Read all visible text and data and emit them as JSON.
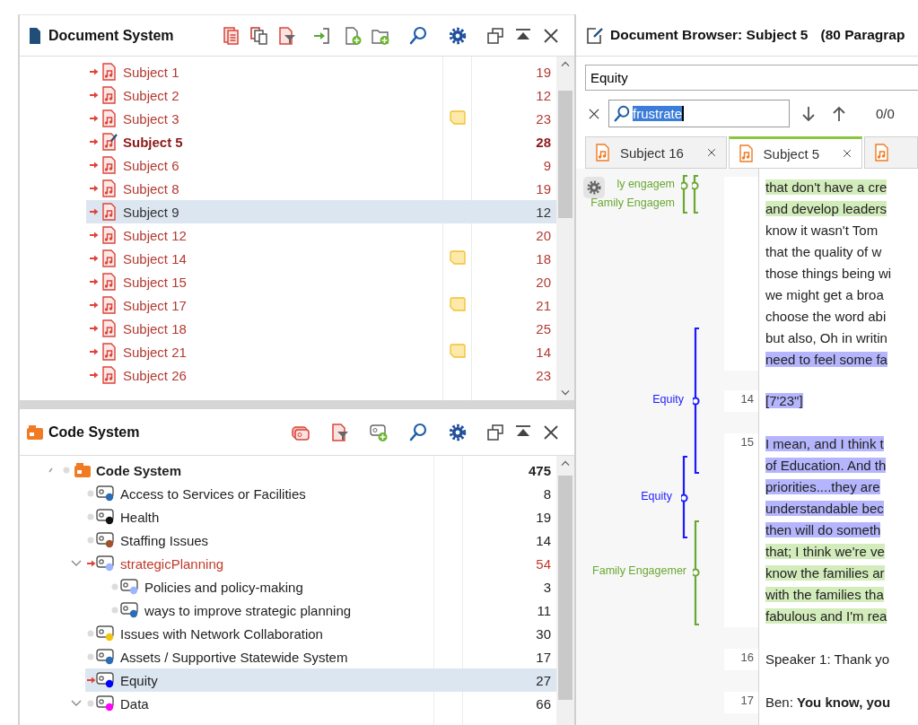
{
  "document_system": {
    "title": "Document System",
    "items": [
      {
        "name": "Subject 1",
        "count": "19",
        "activated": true,
        "selected": false,
        "open": false,
        "memo": false
      },
      {
        "name": "Subject 2",
        "count": "12",
        "activated": true,
        "selected": false,
        "open": false,
        "memo": false
      },
      {
        "name": "Subject 3",
        "count": "23",
        "activated": true,
        "selected": false,
        "open": false,
        "memo": true
      },
      {
        "name": "Subject 5",
        "count": "28",
        "activated": true,
        "selected": false,
        "open": true,
        "memo": false
      },
      {
        "name": "Subject 6",
        "count": "9",
        "activated": true,
        "selected": false,
        "open": false,
        "memo": false
      },
      {
        "name": "Subject 8",
        "count": "19",
        "activated": true,
        "selected": false,
        "open": false,
        "memo": false
      },
      {
        "name": "Subject 9",
        "count": "12",
        "activated": true,
        "selected": true,
        "open": false,
        "memo": false
      },
      {
        "name": "Subject 12",
        "count": "20",
        "activated": true,
        "selected": false,
        "open": false,
        "memo": false
      },
      {
        "name": "Subject 14",
        "count": "18",
        "activated": true,
        "selected": false,
        "open": false,
        "memo": true
      },
      {
        "name": "Subject 15",
        "count": "20",
        "activated": true,
        "selected": false,
        "open": false,
        "memo": false
      },
      {
        "name": "Subject 17",
        "count": "21",
        "activated": true,
        "selected": false,
        "open": false,
        "memo": true
      },
      {
        "name": "Subject 18",
        "count": "25",
        "activated": true,
        "selected": false,
        "open": false,
        "memo": false
      },
      {
        "name": "Subject 21",
        "count": "14",
        "activated": true,
        "selected": false,
        "open": false,
        "memo": true
      },
      {
        "name": "Subject 26",
        "count": "23",
        "activated": true,
        "selected": false,
        "open": false,
        "memo": false
      }
    ]
  },
  "code_system": {
    "title": "Code System",
    "items": [
      {
        "name": "Code System",
        "count": "475",
        "kind": "root",
        "activated": false,
        "selected": false,
        "expanded": true,
        "children": [
          {
            "name": "Access to Services or Facilities",
            "count": "8",
            "kind": "code",
            "color": "#2a6db5",
            "activated": false,
            "selected": false
          },
          {
            "name": "Health",
            "count": "19",
            "kind": "code",
            "color": "#111111",
            "activated": false,
            "selected": false
          },
          {
            "name": "Staffing Issues",
            "count": "14",
            "kind": "code",
            "color": "#a0522d",
            "activated": false,
            "selected": false
          },
          {
            "name": "strategicPlanning",
            "count": "54",
            "kind": "code",
            "color": "#9db4ff",
            "activated": true,
            "selected": false,
            "expanded": true,
            "children": [
              {
                "name": "Policies and policy-making",
                "count": "3",
                "kind": "code",
                "color": "#9db4ff",
                "activated": false,
                "selected": false
              },
              {
                "name": "ways to improve strategic planning",
                "count": "11",
                "kind": "code",
                "color": "#2a6db5",
                "activated": false,
                "selected": false
              }
            ]
          },
          {
            "name": "Issues with Network Collaboration",
            "count": "30",
            "kind": "code",
            "color": "#f2c40f",
            "activated": false,
            "selected": false
          },
          {
            "name": "Assets / Supportive Statewide System",
            "count": "17",
            "kind": "code",
            "color": "#2a6db5",
            "activated": false,
            "selected": false
          },
          {
            "name": "Equity",
            "count": "27",
            "kind": "code",
            "color": "#0000ff",
            "activated": true,
            "selected": true
          },
          {
            "name": "Data",
            "count": "66",
            "kind": "code",
            "color": "#ff00ff",
            "activated": false,
            "selected": false,
            "expanded": true
          }
        ]
      }
    ]
  },
  "browser": {
    "title": "Document Browser: Subject 5",
    "subtitle": "(80 Paragrap",
    "code_filter": {
      "value": "Equity"
    },
    "search": {
      "value": "frustrate",
      "matches": "0/0"
    },
    "tabs": [
      {
        "label": "Subject 16",
        "selected": false
      },
      {
        "label": "Subject 5",
        "selected": true
      },
      {
        "selected": false
      }
    ],
    "stripes": [
      {
        "label": "ly engagem",
        "color": "#6aa832"
      },
      {
        "label": "Family Engagem",
        "color": "#6aa832"
      },
      {
        "label": "Equity",
        "color": "#1a1aff"
      },
      {
        "label": "Equity",
        "color": "#1a1aff"
      },
      {
        "label": "Family Engagemer",
        "color": "#6aa832"
      }
    ],
    "paragraphs": [
      {
        "lines": [
          {
            "text": "that don't have a cre",
            "color": "#d3ecbb"
          },
          {
            "text": "and develop leaders",
            "color": "#d3ecbb"
          },
          {
            "text": "know it wasn't Tom"
          },
          {
            "text": "that the quality of w"
          },
          {
            "text": "those things being wi"
          },
          {
            "text": "we might get a broa"
          },
          {
            "text": "choose the word abi"
          },
          {
            "text": "but also, Oh in writin"
          },
          {
            "text": "need to feel some fa",
            "color": "#b5b5fd"
          }
        ]
      },
      {
        "number": "14",
        "lines": [
          {
            "text": "[7'23\"]",
            "color": "#b5b5fd"
          }
        ]
      },
      {
        "number": "15",
        "lines": [
          {
            "text": "I mean, and I think t",
            "color": "#b5b5fd"
          },
          {
            "text": "of Education. And th",
            "color": "#b5b5fd"
          },
          {
            "text": "priorities....they are",
            "color": "#b5b5fd"
          },
          {
            "text": "understandable bec",
            "color": "#b5b5fd"
          },
          {
            "text": "then will do someth",
            "color": "#b5b5fd"
          },
          {
            "text": "that; I think we're ve",
            "color": "#d3ecbb"
          },
          {
            "text": "know the families ar",
            "color": "#d3ecbb"
          },
          {
            "text": "with the families tha",
            "color": "#d3ecbb"
          },
          {
            "text": "fabulous and I'm rea",
            "color": "#d3ecbb"
          }
        ]
      },
      {
        "number": "16",
        "lines": [
          {
            "text": "Speaker 1: Thank yo"
          }
        ]
      },
      {
        "number": "17",
        "lines": [
          {
            "text": "Ben: **You know, you**"
          }
        ]
      }
    ]
  }
}
